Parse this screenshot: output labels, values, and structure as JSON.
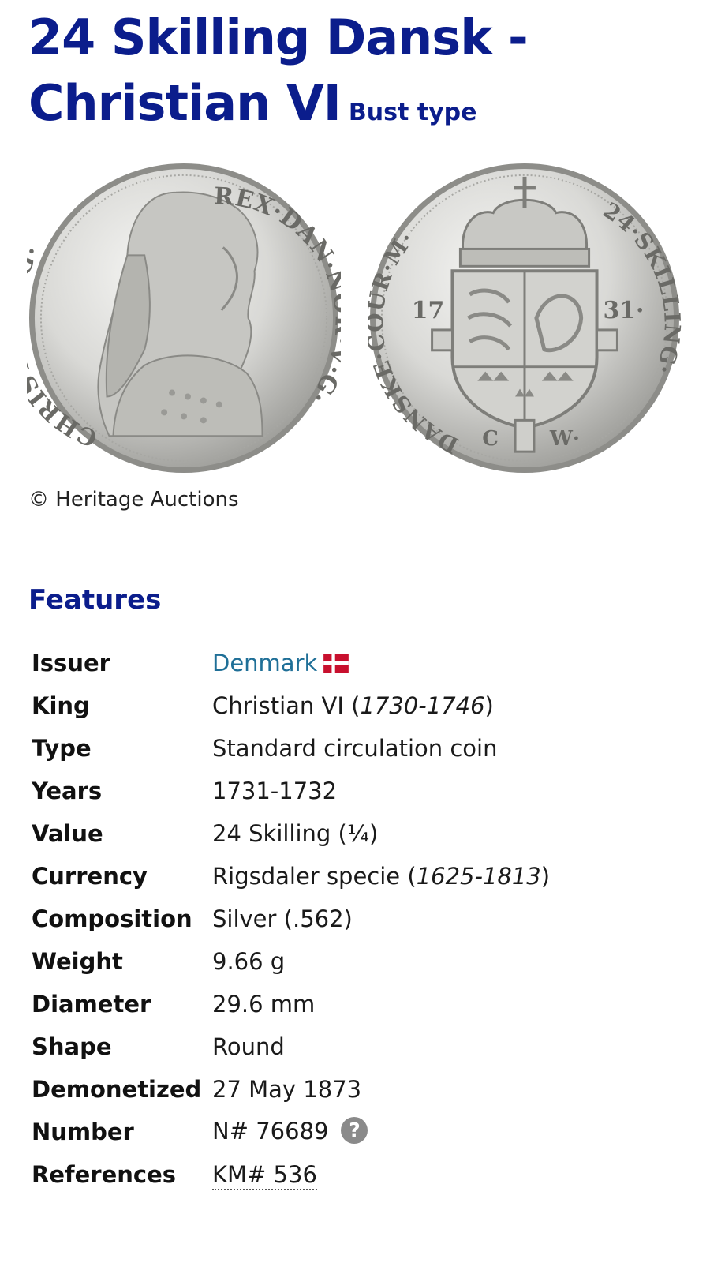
{
  "title": {
    "main": "24 Skilling Dansk - Christian VI",
    "subtitle": "Bust type"
  },
  "images": {
    "obverse": {
      "legend_left": "CHRIST·VI·D·G·",
      "legend_right": "REX·DAN·NOR·V·G·"
    },
    "reverse": {
      "legend_left": "DANSKE·COUR·M·",
      "legend_right": "24·SKILLING·",
      "year_left": "17",
      "year_right": "31·",
      "mint_left": "C",
      "mint_right": "W·"
    },
    "copyright": "© Heritage Auctions"
  },
  "features": {
    "heading": "Features",
    "rows": {
      "issuer": {
        "label": "Issuer",
        "value": "Denmark",
        "flag_icon": "denmark-flag-icon"
      },
      "king": {
        "label": "King",
        "name": "Christian VI",
        "open": " (",
        "period": "1730-1746",
        "close": ")"
      },
      "type": {
        "label": "Type",
        "value": "Standard circulation coin"
      },
      "years": {
        "label": "Years",
        "value": "1731-1732"
      },
      "value": {
        "label": "Value",
        "value": "24 Skilling (¼)"
      },
      "currency": {
        "label": "Currency",
        "name": "Rigsdaler specie (",
        "period": "1625-1813",
        "close": ")"
      },
      "composition": {
        "label": "Composition",
        "value": "Silver (.562)"
      },
      "weight": {
        "label": "Weight",
        "value": "9.66 g"
      },
      "diameter": {
        "label": "Diameter",
        "value": "29.6 mm"
      },
      "shape": {
        "label": "Shape",
        "value": "Round"
      },
      "demonetized": {
        "label": "Demonetized",
        "value": "27 May 1873"
      },
      "number": {
        "label": "Number",
        "value": "N# 76689",
        "help_glyph": "?"
      },
      "references": {
        "label": "References",
        "value": "KM# 536"
      }
    }
  },
  "colors": {
    "heading": "#0b1d8c",
    "link": "#1f6f97",
    "danish_red": "#c8102e"
  }
}
